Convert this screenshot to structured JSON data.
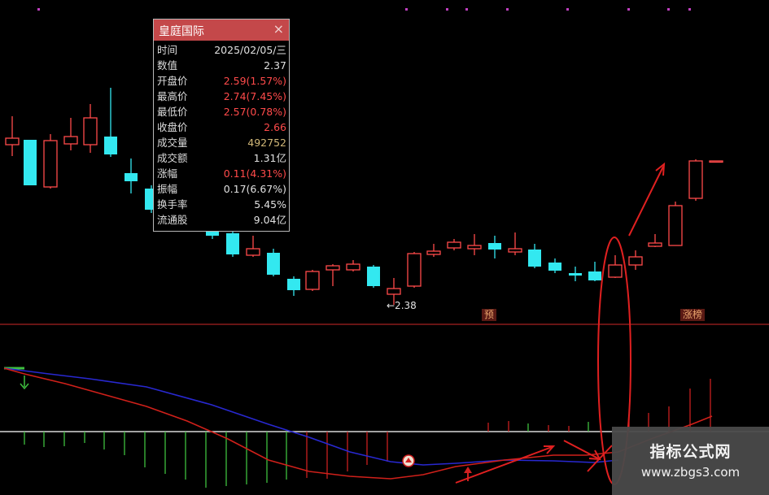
{
  "info_panel": {
    "title": "皇庭国际",
    "close_label": "×",
    "rows": [
      {
        "label": "时间",
        "value": "2025/02/05/三",
        "color": "white"
      },
      {
        "label": "数值",
        "value": "2.37",
        "color": "white"
      },
      {
        "label": "开盘价",
        "value": "2.59(1.57%)",
        "color": "red"
      },
      {
        "label": "最高价",
        "value": "2.74(7.45%)",
        "color": "red"
      },
      {
        "label": "最低价",
        "value": "2.57(0.78%)",
        "color": "red"
      },
      {
        "label": "收盘价",
        "value": "2.66",
        "color": "red"
      },
      {
        "label": "成交量",
        "value": "492752",
        "color": "gold"
      },
      {
        "label": "成交额",
        "value": "1.31亿",
        "color": "white"
      },
      {
        "label": "涨幅",
        "value": "0.11(4.31%)",
        "color": "red"
      },
      {
        "label": "振幅",
        "value": "0.17(6.67%)",
        "color": "white"
      },
      {
        "label": "换手率",
        "value": "5.45%",
        "color": "white"
      },
      {
        "label": "流通股",
        "value": "9.04亿",
        "color": "white"
      }
    ]
  },
  "low_price_label": "←2.38",
  "tags": {
    "yu": "预",
    "zhangbang": "涨榜"
  },
  "watermark": {
    "title": "指标公式网",
    "url": "www.zbgs3.com"
  },
  "colors": {
    "background": "#000000",
    "up": "#ff4a4a",
    "down": "#33e8f0",
    "divider": "#8a1a1a",
    "fast_line": "#d0201a",
    "slow_line": "#2020c8",
    "histogram_neg": "#3fbf3f",
    "annotation": "#e02020"
  }
}
